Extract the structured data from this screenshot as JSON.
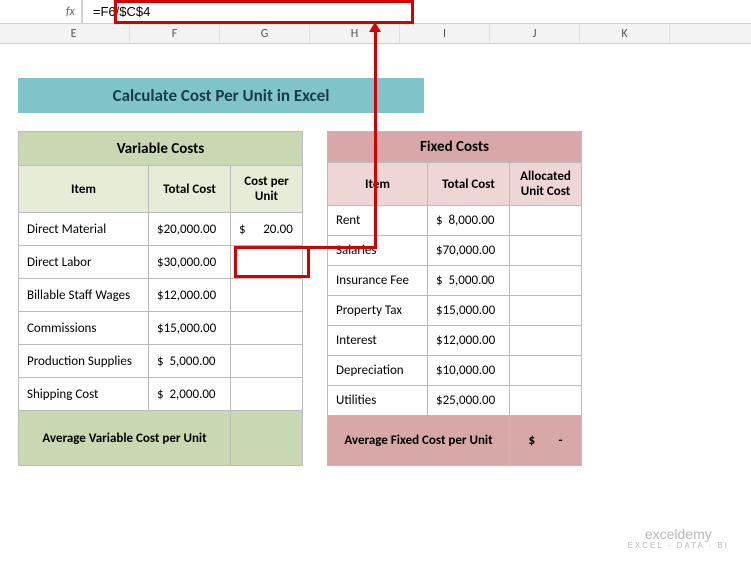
{
  "formula_bar": {
    "fx_label": "fx",
    "formula": "=F6/$C$4"
  },
  "columns": [
    "E",
    "F",
    "G",
    "H",
    "I",
    "J",
    "K"
  ],
  "title": "Calculate Cost Per Unit in Excel",
  "variable": {
    "header": "Variable Costs",
    "col_item": "Item",
    "col_total": "Total Cost",
    "col_cpu": "Cost per Unit",
    "rows": [
      {
        "item": "Direct Material",
        "total": "$20,000.00",
        "cpu": "$      20.00"
      },
      {
        "item": "Direct Labor",
        "total": "$30,000.00",
        "cpu": ""
      },
      {
        "item": "Billable Staff Wages",
        "total": "$12,000.00",
        "cpu": ""
      },
      {
        "item": "Commissions",
        "total": "$15,000.00",
        "cpu": ""
      },
      {
        "item": "Production Supplies",
        "total": "$  5,000.00",
        "cpu": ""
      },
      {
        "item": "Shipping Cost",
        "total": "$  2,000.00",
        "cpu": ""
      }
    ],
    "footer": "Average Variable Cost per Unit",
    "footer_val": ""
  },
  "fixed": {
    "header": "Fixed Costs",
    "col_item": "Item",
    "col_total": "Total Cost",
    "col_alloc": "Allocated Unit Cost",
    "rows": [
      {
        "item": "Rent",
        "total": "$  8,000.00",
        "alloc": ""
      },
      {
        "item": "Salaries",
        "total": "$70,000.00",
        "alloc": ""
      },
      {
        "item": "Insurance Fee",
        "total": "$  5,000.00",
        "alloc": ""
      },
      {
        "item": "Property Tax",
        "total": "$15,000.00",
        "alloc": ""
      },
      {
        "item": "Interest",
        "total": "$12,000.00",
        "alloc": ""
      },
      {
        "item": "Depreciation",
        "total": "$10,000.00",
        "alloc": ""
      },
      {
        "item": "Utilities",
        "total": "$25,000.00",
        "alloc": ""
      }
    ],
    "footer": "Average Fixed Cost per Unit",
    "footer_val": "$        -"
  },
  "watermark": {
    "main": "exceldemy",
    "sub": "EXCEL · DATA · BI"
  }
}
